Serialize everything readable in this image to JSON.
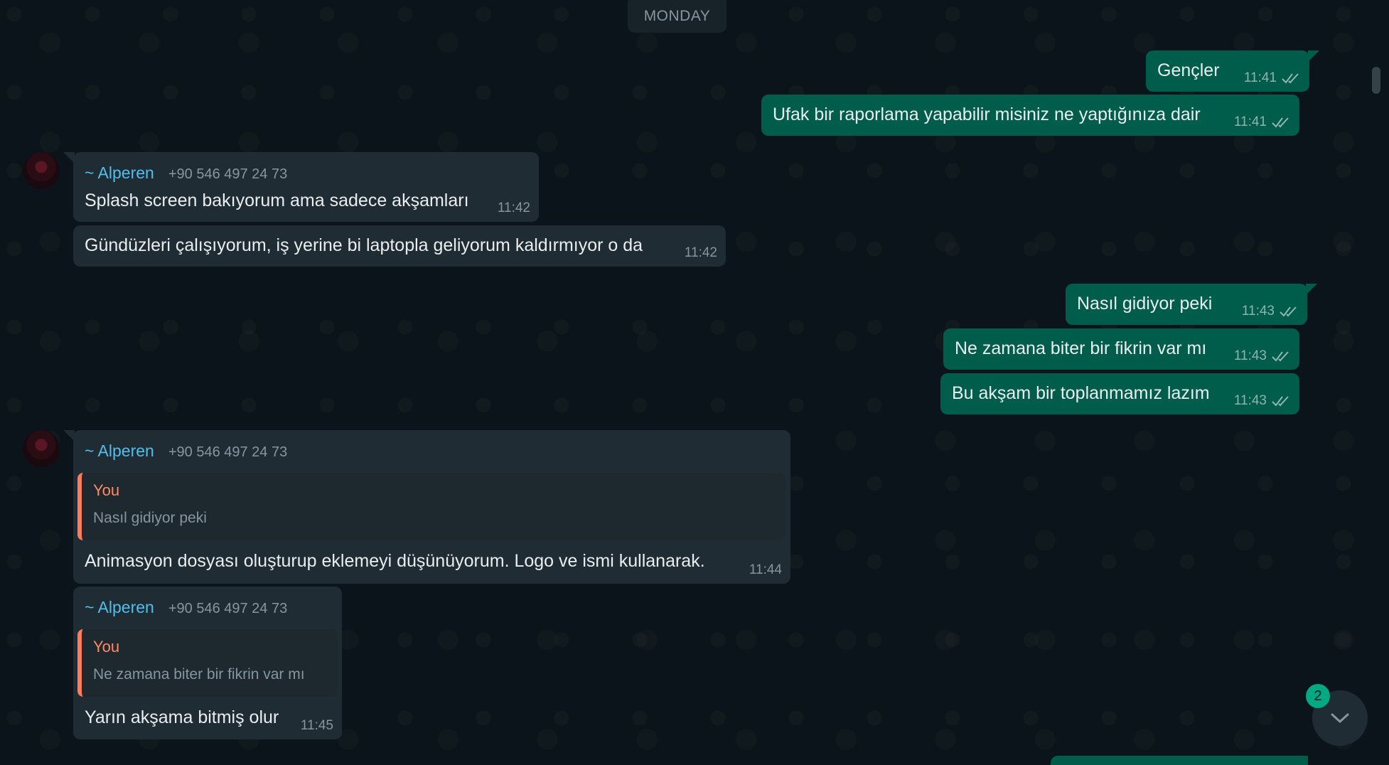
{
  "date_separator": "MONDAY",
  "outgoing": [
    {
      "text": "Gençler",
      "time": "11:41"
    },
    {
      "text": "Ufak bir raporlama yapabilir misiniz ne yaptığınıza dair",
      "time": "11:41"
    },
    {
      "text": "Nasıl gidiyor peki",
      "time": "11:43"
    },
    {
      "text": "Ne zamana biter bir fikrin var mı",
      "time": "11:43"
    },
    {
      "text": "Bu akşam bir toplanmamız lazım",
      "time": "11:43"
    }
  ],
  "incoming": [
    {
      "sender": "~ Alperen",
      "phone": "+90 546 497 24 73",
      "text": "Splash screen bakıyorum ama sadece akşamları",
      "time": "11:42"
    },
    {
      "text": "Gündüzleri çalışıyorum, iş yerine bi laptopla geliyorum kaldırmıyor o da",
      "time": "11:42"
    },
    {
      "sender": "~ Alperen",
      "phone": "+90 546 497 24 73",
      "quote_author": "You",
      "quote_text": "Nasıl gidiyor peki",
      "text": "Animasyon dosyası oluşturup eklemeyi düşünüyorum. Logo ve ismi kullanarak.",
      "time": "11:44"
    },
    {
      "sender": "~ Alperen",
      "phone": "+90 546 497 24 73",
      "quote_author": "You",
      "quote_text": "Ne zamana biter bir fikrin var mı",
      "text": "Yarın akşama bitmiş olur",
      "time": "11:45"
    }
  ],
  "scroll_down": {
    "icon": "chevron-down-icon",
    "unread_count": "2"
  },
  "colors": {
    "background": "#0b141a",
    "outgoing_bubble": "#005c4b",
    "incoming_bubble": "#202c33",
    "sender_name": "#53bdeb",
    "quote_accent": "#ff7b5c",
    "unread_badge": "#00a884"
  }
}
